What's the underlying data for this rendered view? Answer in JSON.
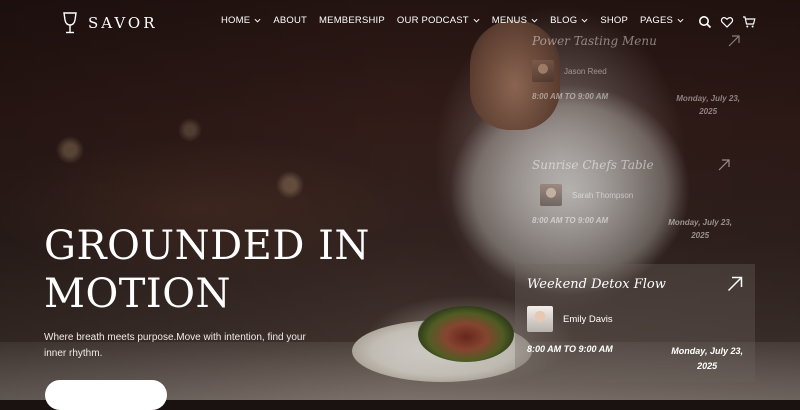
{
  "brand": {
    "name": "SAVOR"
  },
  "nav": {
    "items": [
      {
        "label": "HOME",
        "dropdown": true
      },
      {
        "label": "ABOUT",
        "dropdown": false
      },
      {
        "label": "MEMBERSHIP",
        "dropdown": false
      },
      {
        "label": "OUR PODCAST",
        "dropdown": true
      },
      {
        "label": "MENUS",
        "dropdown": true
      },
      {
        "label": "BLOG",
        "dropdown": true
      },
      {
        "label": "SHOP",
        "dropdown": false
      },
      {
        "label": "PAGES",
        "dropdown": true
      }
    ],
    "icons": [
      "search-icon",
      "heart-icon",
      "cart-icon"
    ]
  },
  "hero": {
    "title_line1": "GROUNDED IN",
    "title_line2": "MOTION",
    "subtitle": "Where breath meets purpose.Move with intention, find your inner rhythm."
  },
  "events": [
    {
      "title": "Power Tasting Menu",
      "host": "Jason Reed",
      "time": "8:00 AM TO 9:00 AM",
      "date_line1": "Monday, July 23,",
      "date_line2": "2025"
    },
    {
      "title": "Sunrise Chefs Table",
      "host": "Sarah Thompson",
      "time": "8:00 AM TO 9:00 AM",
      "date_line1": "Monday, July 23,",
      "date_line2": "2025"
    },
    {
      "title": "Weekend Detox Flow",
      "host": "Emily Davis",
      "time": "8:00 AM TO 9:00 AM",
      "date_line1": "Monday, July 23,",
      "date_line2": "2025"
    }
  ],
  "colors": {
    "text": "#ffffff",
    "background": "#2a1714"
  }
}
